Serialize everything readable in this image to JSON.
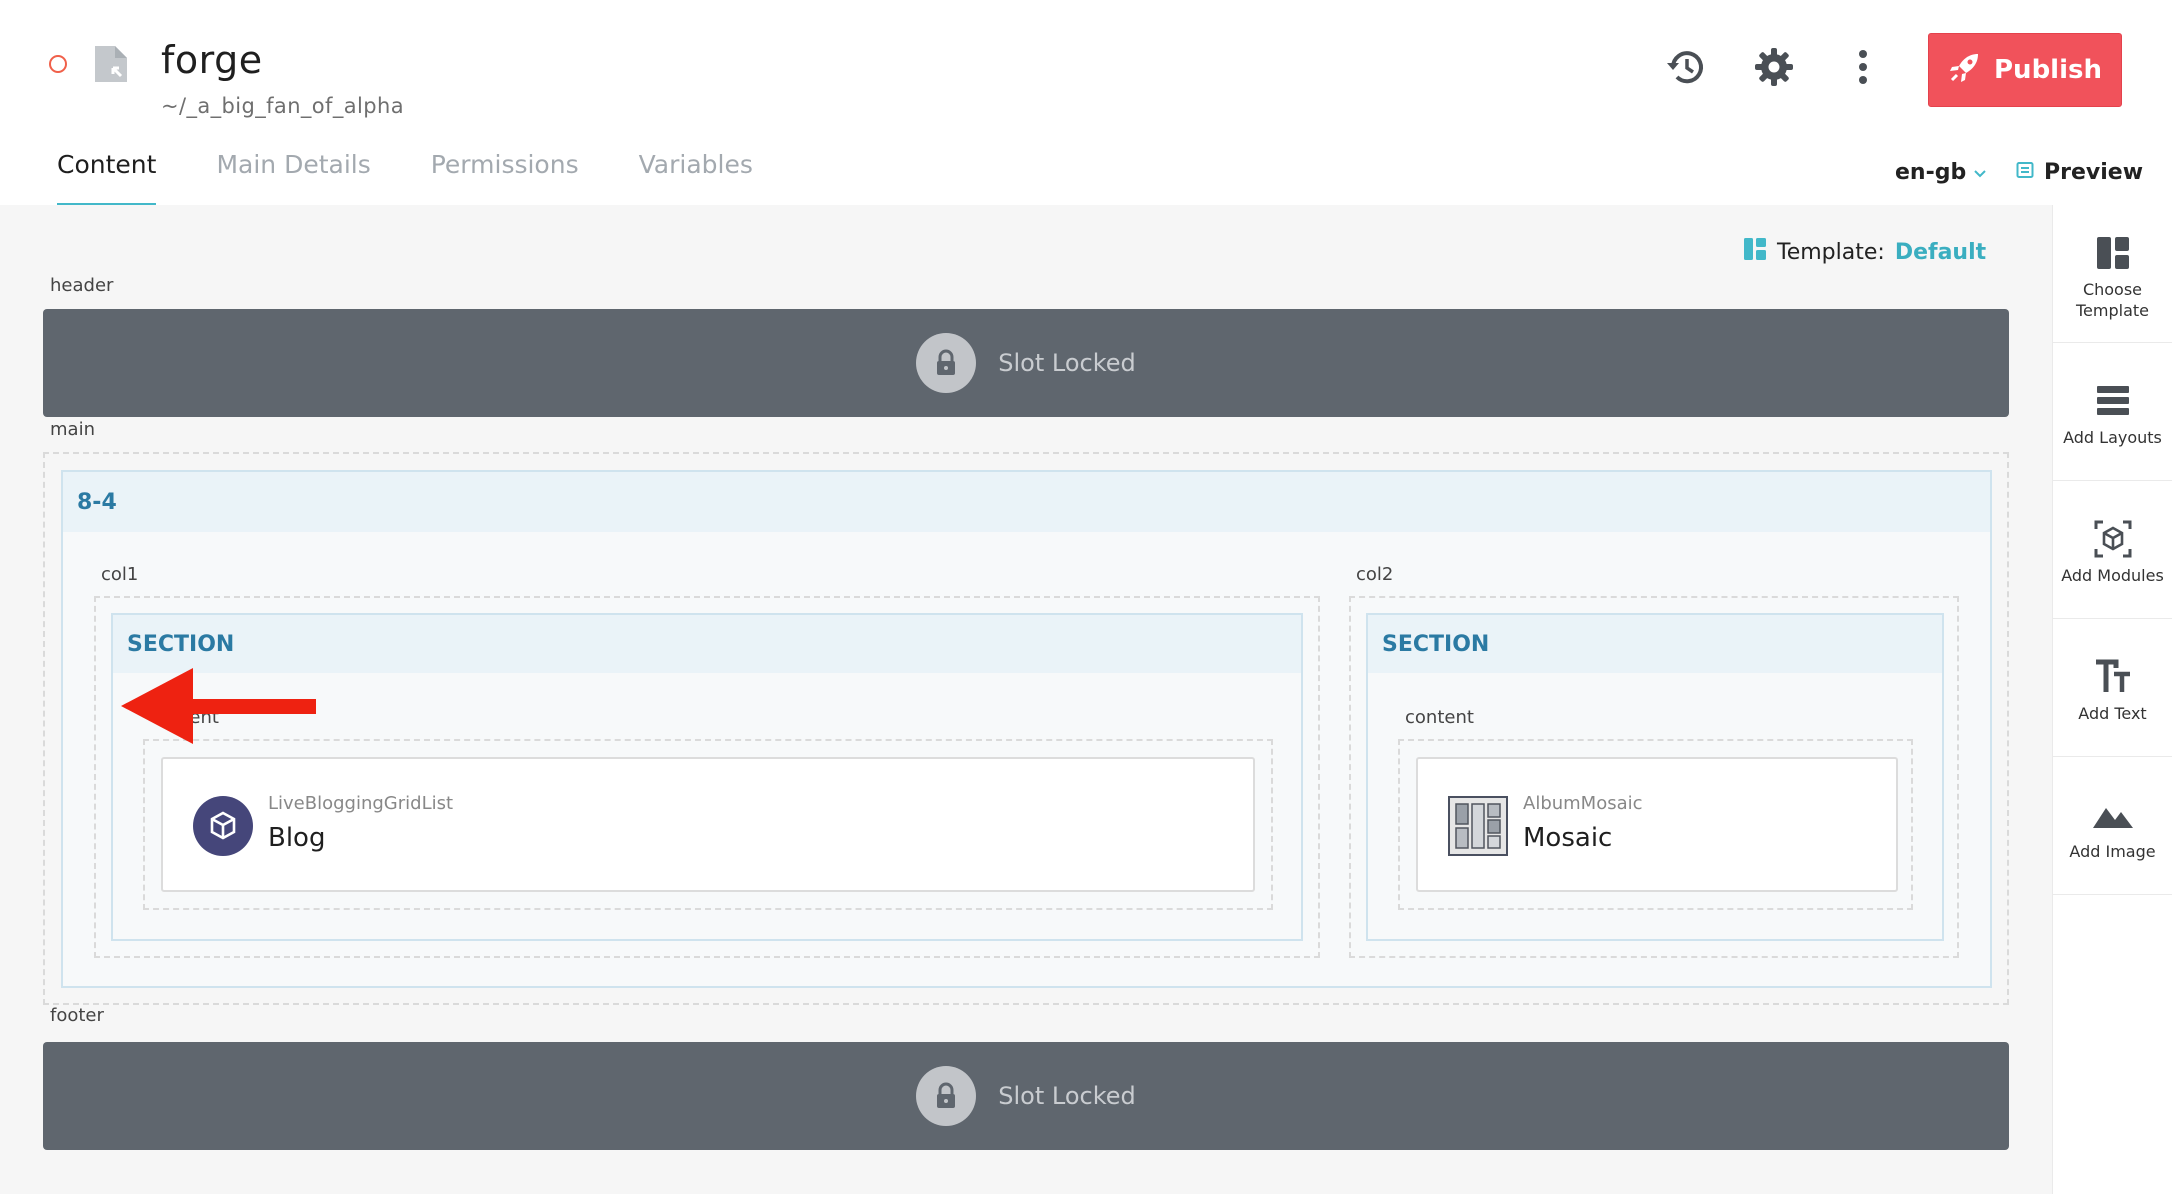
{
  "header": {
    "title": "forge",
    "path": "~/_a_big_fan_of_alpha",
    "publish_label": "Publish",
    "colors": {
      "publish": "#f1525b",
      "status": "#f0604a",
      "accent": "#42b8c9"
    }
  },
  "tabs": [
    {
      "label": "Content"
    },
    {
      "label": "Main Details"
    },
    {
      "label": "Permissions"
    },
    {
      "label": "Variables"
    }
  ],
  "locale": {
    "value": "en-gb"
  },
  "preview": {
    "label": "Preview"
  },
  "template": {
    "label": "Template:",
    "value": "Default"
  },
  "slots": {
    "header": {
      "label": "header",
      "locked_text": "Slot Locked"
    },
    "main": {
      "label": "main"
    },
    "footer": {
      "label": "footer",
      "locked_text": "Slot Locked"
    }
  },
  "layout": {
    "name": "8-4",
    "columns": [
      {
        "label": "col1",
        "section": {
          "title": "SECTION",
          "content_label": "content",
          "module": {
            "type": "LiveBloggingGridList",
            "name": "Blog",
            "icon": "cube-icon"
          }
        }
      },
      {
        "label": "col2",
        "section": {
          "title": "SECTION",
          "content_label": "content",
          "module": {
            "type": "AlbumMosaic",
            "name": "Mosaic",
            "icon": "mosaic-thumbnail"
          }
        }
      }
    ]
  },
  "sidebar": {
    "items": [
      {
        "label": "Choose Template",
        "icon": "template-icon"
      },
      {
        "label": "Add Layouts",
        "icon": "layouts-icon"
      },
      {
        "label": "Add Modules",
        "icon": "modules-icon"
      },
      {
        "label": "Add Text",
        "icon": "text-icon"
      },
      {
        "label": "Add Image",
        "icon": "image-icon"
      }
    ]
  }
}
